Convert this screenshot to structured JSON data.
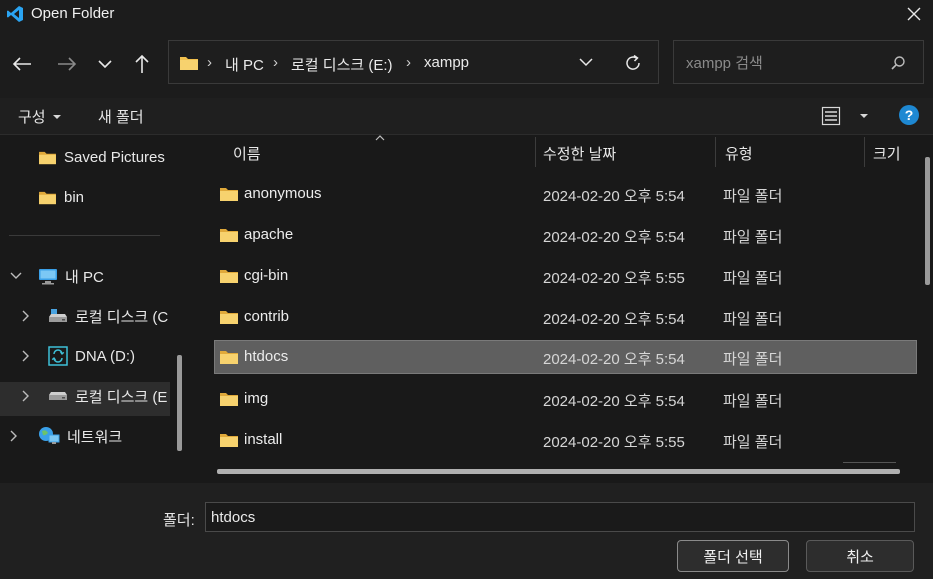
{
  "window": {
    "title": "Open Folder"
  },
  "address": {
    "crumbs": [
      "내 PC",
      "로컬 디스크 (E:)",
      "xampp"
    ],
    "separator": "›"
  },
  "search": {
    "placeholder": "xampp 검색"
  },
  "toolbar": {
    "organize": "구성",
    "new_folder": "새 폴더",
    "help": "?"
  },
  "sidebar": {
    "items": [
      {
        "label": "Saved Pictures",
        "icon": "folder-icon"
      },
      {
        "label": "bin",
        "icon": "folder-icon"
      },
      {
        "label": "내 PC",
        "icon": "computer-icon",
        "expanded": true
      },
      {
        "label": "로컬 디스크 (C",
        "icon": "drive-icon"
      },
      {
        "label": "DNA (D:)",
        "icon": "sync-drive-icon"
      },
      {
        "label": "로컬 디스크 (E",
        "icon": "drive-icon",
        "selected": true
      },
      {
        "label": "네트워크",
        "icon": "network-icon"
      }
    ]
  },
  "columns": {
    "name": "이름",
    "date": "수정한 날짜",
    "type": "유형",
    "size": "크기"
  },
  "files": [
    {
      "name": "anonymous",
      "date": "2024-02-20 오후 5:54",
      "type": "파일 폴더"
    },
    {
      "name": "apache",
      "date": "2024-02-20 오후 5:54",
      "type": "파일 폴더"
    },
    {
      "name": "cgi-bin",
      "date": "2024-02-20 오후 5:55",
      "type": "파일 폴더"
    },
    {
      "name": "contrib",
      "date": "2024-02-20 오후 5:54",
      "type": "파일 폴더"
    },
    {
      "name": "htdocs",
      "date": "2024-02-20 오후 5:54",
      "type": "파일 폴더",
      "selected": true
    },
    {
      "name": "img",
      "date": "2024-02-20 오후 5:54",
      "type": "파일 폴더"
    },
    {
      "name": "install",
      "date": "2024-02-20 오후 5:55",
      "type": "파일 폴더"
    }
  ],
  "footer": {
    "folder_label": "폴더:",
    "folder_value": "htdocs",
    "select_button": "폴더 선택",
    "cancel_button": "취소"
  },
  "colors": {
    "accent": "#1e88d2",
    "folder": "#f2c14e",
    "selected_row": "#5f5f5f",
    "background": "#191919"
  }
}
